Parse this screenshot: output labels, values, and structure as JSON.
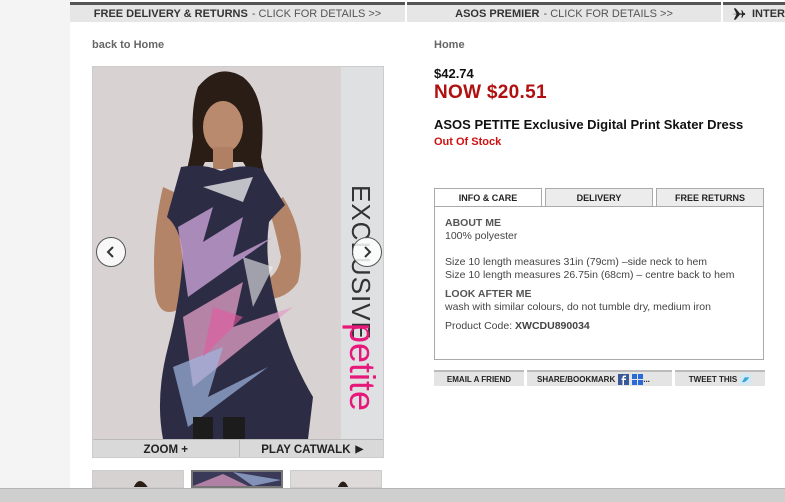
{
  "promo": {
    "delivery_label": "FREE DELIVERY & RETURNS",
    "delivery_cta": "- CLICK FOR DETAILS >>",
    "premier_label": "ASOS PREMIER",
    "premier_cta": "- CLICK FOR DETAILS >>",
    "intl_label": "INTER"
  },
  "nav": {
    "back_link": "back to Home",
    "breadcrumb": "Home"
  },
  "image": {
    "banner_top": "EXCLUSIVE",
    "banner_bottom": "petite",
    "zoom_label": "ZOOM +",
    "catwalk_label": "PLAY CATWALK"
  },
  "product": {
    "was_price": "$42.74",
    "now_price": "NOW $20.51",
    "title": "ASOS PETITE Exclusive Digital Print Skater Dress",
    "stock": "Out Of Stock"
  },
  "tabs": [
    {
      "label": "INFO & CARE"
    },
    {
      "label": "DELIVERY"
    },
    {
      "label": "FREE RETURNS"
    }
  ],
  "info": {
    "about_heading": "ABOUT ME",
    "material": "100% polyester",
    "size_line1": "Size 10 length measures 31in (79cm) –side neck to hem",
    "size_line2": "Size 10 length measures 26.75in (68cm) – centre back to hem",
    "care_heading": "LOOK AFTER ME",
    "care_text": "wash with similar colours, do not tumble dry, medium iron",
    "code_label": "Product Code:",
    "code_value": "XWCDU890034"
  },
  "share": {
    "email": "EMAIL A FRIEND",
    "bookmark": "SHARE/BOOKMARK",
    "bookmark_more": "...",
    "tweet": "TWEET THIS"
  },
  "colors": {
    "sale_red": "#b01010",
    "stock_red": "#d01010",
    "petite_pink": "#e6197a",
    "promo_accent": "#f5e20a"
  }
}
